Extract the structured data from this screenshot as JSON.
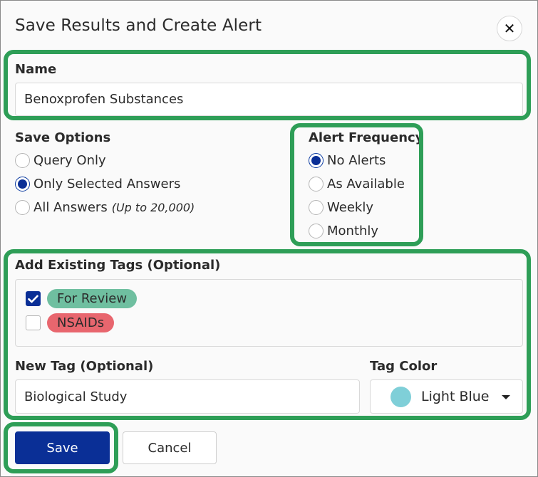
{
  "dialog": {
    "title": "Save Results and Create Alert",
    "close_icon": "close-icon",
    "close_glyph": "✕"
  },
  "name_field": {
    "label": "Name",
    "value": "Benoxprofen Substances"
  },
  "save_options": {
    "label": "Save Options",
    "options": [
      {
        "label": "Query Only",
        "note": "",
        "selected": false
      },
      {
        "label": "Only Selected Answers",
        "note": "",
        "selected": true
      },
      {
        "label": "All Answers",
        "note": "(Up to 20,000)",
        "selected": false
      }
    ]
  },
  "alert_frequency": {
    "label": "Alert Frequency",
    "options": [
      {
        "label": "No Alerts",
        "selected": true
      },
      {
        "label": "As Available",
        "selected": false
      },
      {
        "label": "Weekly",
        "selected": false
      },
      {
        "label": "Monthly",
        "selected": false
      }
    ]
  },
  "existing_tags": {
    "label": "Add Existing Tags (Optional)",
    "tags": [
      {
        "label": "For Review",
        "checked": true,
        "color": "#6fbfa0"
      },
      {
        "label": "NSAIDs",
        "checked": false,
        "color": "#e8666e"
      }
    ]
  },
  "new_tag": {
    "label": "New Tag (Optional)",
    "value": "Biological Study"
  },
  "tag_color": {
    "label": "Tag Color",
    "selected": "Light Blue",
    "swatch_color": "#7fcfd8",
    "icon": "chevron-down-icon"
  },
  "buttons": {
    "save": "Save",
    "cancel": "Cancel"
  },
  "colors": {
    "highlight": "#2e9e57",
    "primary": "#0a2f96"
  }
}
